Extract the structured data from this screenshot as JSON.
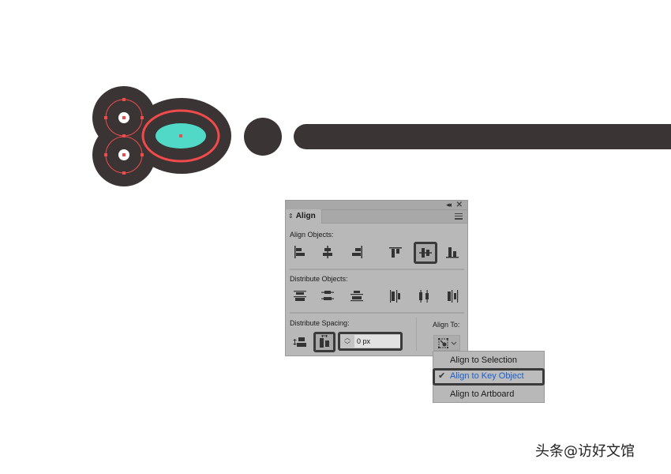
{
  "canvas": {
    "colors": {
      "dark_shape": "#3a3434",
      "selection": "#f04a4a",
      "accent_fill": "#4fd9c6",
      "inner_white": "#ffffff"
    }
  },
  "panel": {
    "title": "Align",
    "collapse_icon": "collapse-icon",
    "close_icon": "close-icon",
    "menu_icon": "panel-menu-icon",
    "align_objects": {
      "label": "Align Objects:",
      "buttons": [
        {
          "name": "horizontal-align-left",
          "selected": false
        },
        {
          "name": "horizontal-align-center",
          "selected": false
        },
        {
          "name": "horizontal-align-right",
          "selected": false
        },
        {
          "name": "vertical-align-top",
          "selected": false
        },
        {
          "name": "vertical-align-center",
          "selected": true
        },
        {
          "name": "vertical-align-bottom",
          "selected": false
        }
      ]
    },
    "distribute_objects": {
      "label": "Distribute Objects:",
      "buttons": [
        {
          "name": "vertical-distribute-top"
        },
        {
          "name": "vertical-distribute-center"
        },
        {
          "name": "vertical-distribute-bottom"
        },
        {
          "name": "horizontal-distribute-left"
        },
        {
          "name": "horizontal-distribute-center"
        },
        {
          "name": "horizontal-distribute-right"
        }
      ]
    },
    "distribute_spacing": {
      "label": "Distribute Spacing:",
      "buttons": [
        {
          "name": "vertical-distribute-space",
          "selected": false
        },
        {
          "name": "horizontal-distribute-space",
          "selected": true
        }
      ],
      "spacing_value": "0 px"
    },
    "align_to": {
      "label": "Align To:"
    }
  },
  "dropdown": {
    "items": [
      {
        "label": "Align to Selection",
        "checked": false
      },
      {
        "label": "Align to Key Object",
        "checked": true
      },
      {
        "label": "Align to Artboard",
        "checked": false
      }
    ],
    "check_glyph": "✔"
  },
  "watermark": "头条@访好文馆"
}
